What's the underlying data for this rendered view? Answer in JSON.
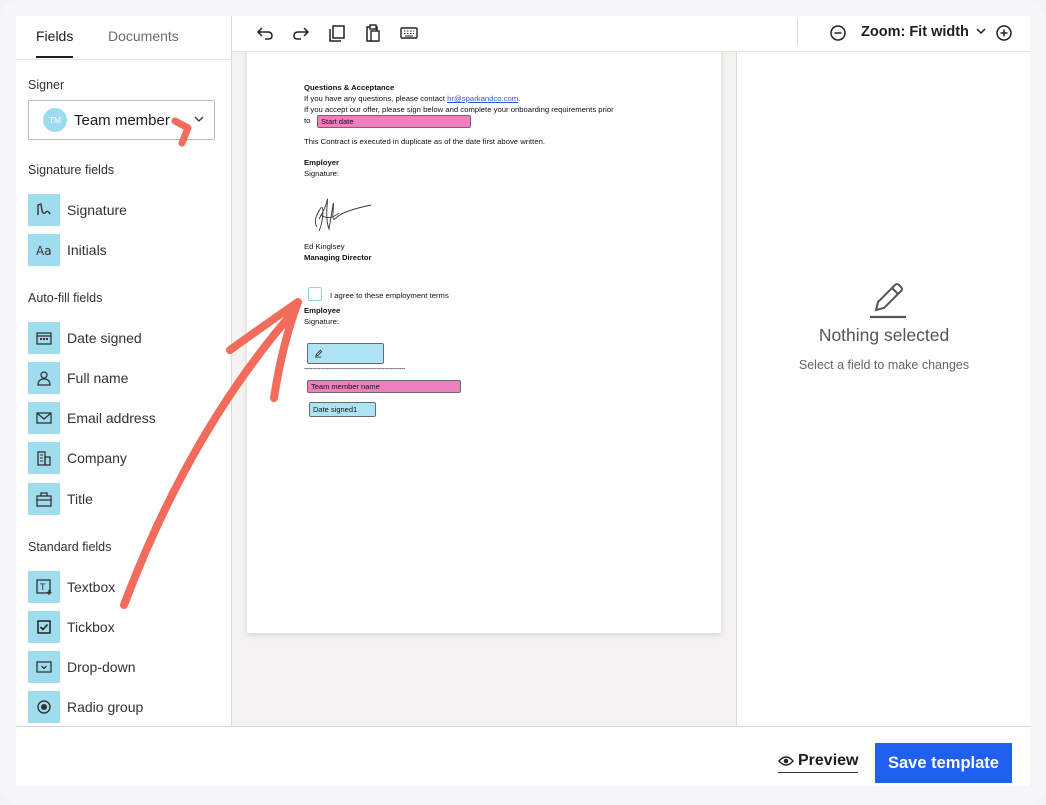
{
  "tabs": {
    "fields": "Fields",
    "documents": "Documents"
  },
  "signer": {
    "section_label": "Signer",
    "avatar_initials": "TM",
    "selected": "Team member"
  },
  "sections": {
    "signature": "Signature fields",
    "autofill": "Auto-fill fields",
    "standard": "Standard fields"
  },
  "signature_fields": [
    {
      "label": "Signature",
      "icon": "signature-icon"
    },
    {
      "label": "Initials",
      "icon": "initials-icon"
    }
  ],
  "autofill_fields": [
    {
      "label": "Date signed",
      "icon": "calendar-icon"
    },
    {
      "label": "Full name",
      "icon": "person-icon"
    },
    {
      "label": "Email address",
      "icon": "envelope-icon"
    },
    {
      "label": "Company",
      "icon": "building-icon"
    },
    {
      "label": "Title",
      "icon": "briefcase-icon"
    }
  ],
  "standard_fields": [
    {
      "label": "Textbox",
      "icon": "textbox-icon"
    },
    {
      "label": "Tickbox",
      "icon": "checkbox-icon"
    },
    {
      "label": "Drop-down",
      "icon": "dropdown-icon"
    },
    {
      "label": "Radio group",
      "icon": "radio-icon"
    }
  ],
  "toolbar": {
    "zoom_label": "Zoom: Fit width"
  },
  "document": {
    "heading": "Questions & Acceptance",
    "line1_pre": "If you have any questions, please contact ",
    "line1_link": "hr@sparkandco.com",
    "line1_post": ".",
    "line2": "If you accept our offer, please sign below and complete your onboarding requirements prior",
    "line3_pre": "to",
    "start_date_field": "Start date",
    "duplicate_line": "This Contract is executed in duplicate as of the date first above written.",
    "employer_heading": "Employer",
    "employer_sig_label": "Signature:",
    "employer_name": "Ed Kinglsey",
    "employer_title": "Managing Director",
    "agree_label": "I agree to these employment terms",
    "employee_heading": "Employee",
    "employee_sig_label": "Signature:",
    "divider_line": "-------------------------------------------------",
    "team_member_field": "Team member name",
    "date_signed_field": "Date signed1"
  },
  "properties": {
    "title": "Nothing selected",
    "subtitle": "Select a field to make changes"
  },
  "footer": {
    "preview_label": "Preview",
    "save_label": "Save template"
  },
  "colors": {
    "accent": "#1f60ee",
    "field_icon_bg": "#9fdcee",
    "pink_field": "#f07fc0",
    "blue_field": "#aee3f3",
    "annotation_arrow": "#f26b5b"
  }
}
